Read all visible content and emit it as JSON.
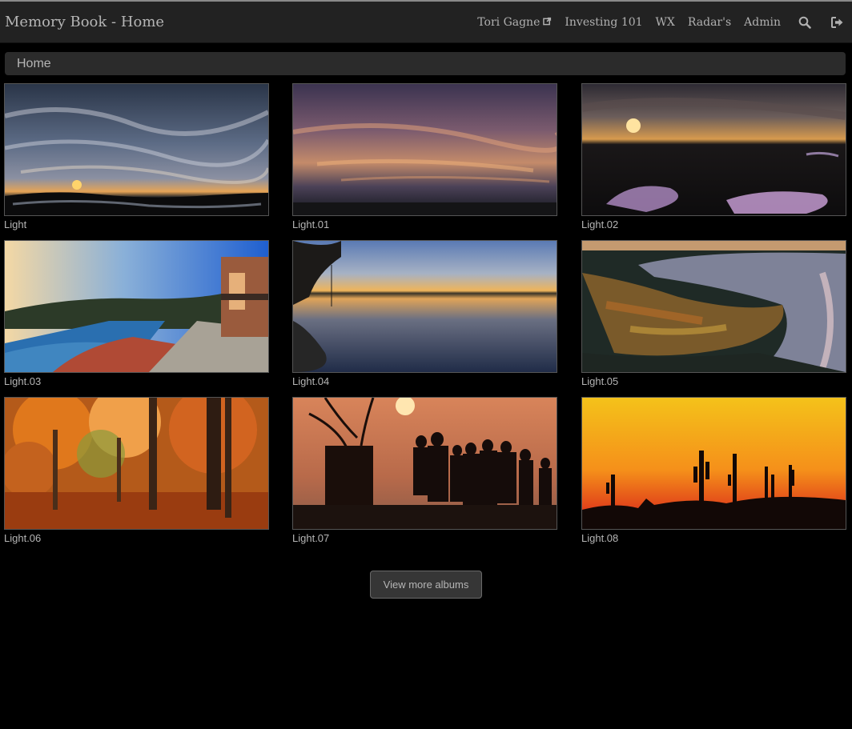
{
  "navbar": {
    "brand": "Memory Book - Home",
    "links": [
      {
        "label": "Tori Gagne"
      },
      {
        "label": "Investing 101"
      },
      {
        "label": "WX"
      },
      {
        "label": "Radar's"
      },
      {
        "label": "Admin"
      }
    ],
    "icons": {
      "external_link": "external-link-icon",
      "search": "search-icon",
      "logout": "logout-icon"
    }
  },
  "breadcrumb": {
    "current": "Home"
  },
  "albums": [
    {
      "caption": "Light"
    },
    {
      "caption": "Light.01"
    },
    {
      "caption": "Light.02"
    },
    {
      "caption": "Light.03"
    },
    {
      "caption": "Light.04"
    },
    {
      "caption": "Light.05"
    },
    {
      "caption": "Light.06"
    },
    {
      "caption": "Light.07"
    },
    {
      "caption": "Light.08"
    }
  ],
  "more_button": {
    "label": "View more albums"
  },
  "colors": {
    "background": "#000000",
    "navbar": "#222222",
    "text": "#b5b5b5"
  }
}
